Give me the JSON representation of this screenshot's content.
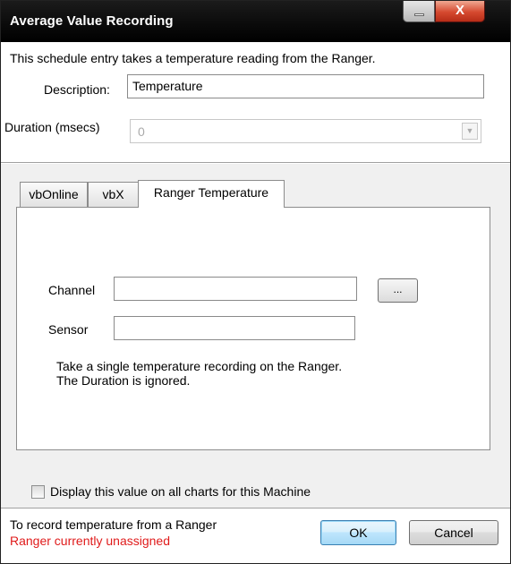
{
  "window": {
    "title": "Average Value Recording",
    "close_glyph": "X",
    "minimize_icon": "minimize-icon"
  },
  "intro_text": "This schedule entry takes a temperature reading from the Ranger.",
  "description": {
    "label": "Description:",
    "value": "Temperature"
  },
  "duration": {
    "label": "Duration (msecs)",
    "value": "0",
    "arrow_glyph": "▼"
  },
  "tabs": [
    {
      "label": "vbOnline",
      "active": false
    },
    {
      "label": "vbX",
      "active": false
    },
    {
      "label": "Ranger Temperature",
      "active": true
    }
  ],
  "ranger_tab": {
    "channel_label": "Channel",
    "channel_value": "",
    "browse_label": "...",
    "sensor_label": "Sensor",
    "sensor_value": "",
    "info_line1": "Take a single temperature recording on the Ranger.",
    "info_line2": "The Duration is ignored."
  },
  "display_all_charts": {
    "label": "Display this value on all charts for this Machine",
    "checked": false
  },
  "status": {
    "line1": "To record temperature from a Ranger",
    "line2": "Ranger currently unassigned",
    "line2_color": "#e01b1b"
  },
  "buttons": {
    "ok": "OK",
    "cancel": "Cancel"
  }
}
